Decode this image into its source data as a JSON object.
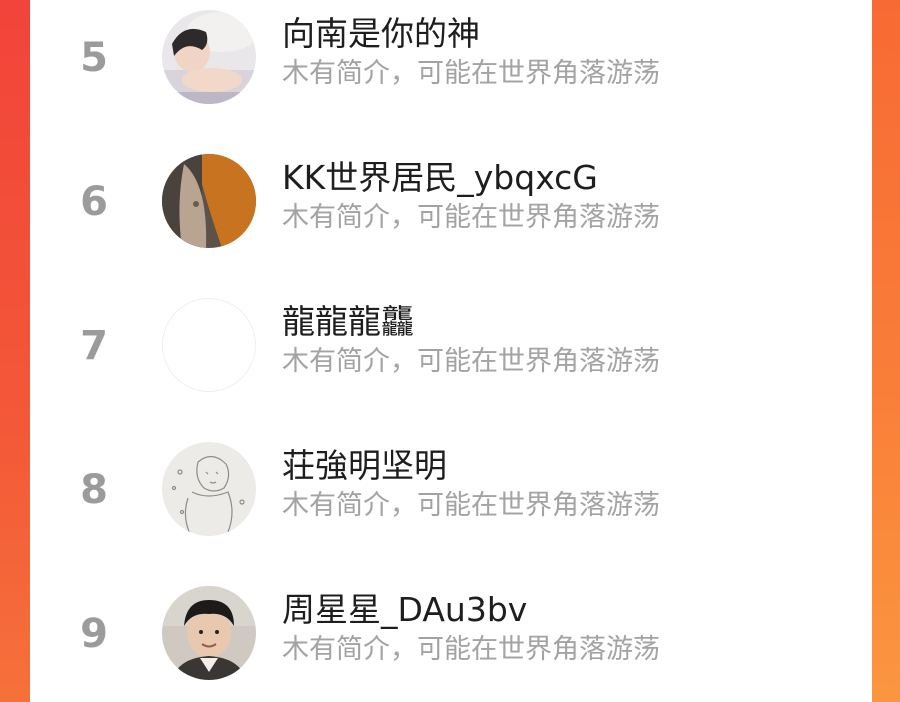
{
  "users": [
    {
      "rank": "5",
      "name": "向南是你的神",
      "bio": "木有简介，可能在世界角落游荡",
      "avatar_icon": "user-photo-avatar"
    },
    {
      "rank": "6",
      "name": "KK世界居民_ybqxcG",
      "bio": "木有简介，可能在世界角落游荡",
      "avatar_icon": "user-photo-avatar"
    },
    {
      "rank": "7",
      "name": "龍龍龍龘",
      "bio": "木有简介，可能在世界角落游荡",
      "avatar_icon": "blank-avatar"
    },
    {
      "rank": "8",
      "name": "荘強明坚明",
      "bio": "木有简介，可能在世界角落游荡",
      "avatar_icon": "sketch-avatar"
    },
    {
      "rank": "9",
      "name": "周星星_DAu3bv",
      "bio": "木有简介，可能在世界角落游荡",
      "avatar_icon": "user-photo-avatar"
    }
  ],
  "colors": {
    "background_gradient_top": "#f4503a",
    "background_gradient_bottom": "#f98a3c",
    "rank_gray": "#9b9b9b",
    "name_text": "#1e1e1e",
    "bio_text": "#a3a3a3"
  }
}
